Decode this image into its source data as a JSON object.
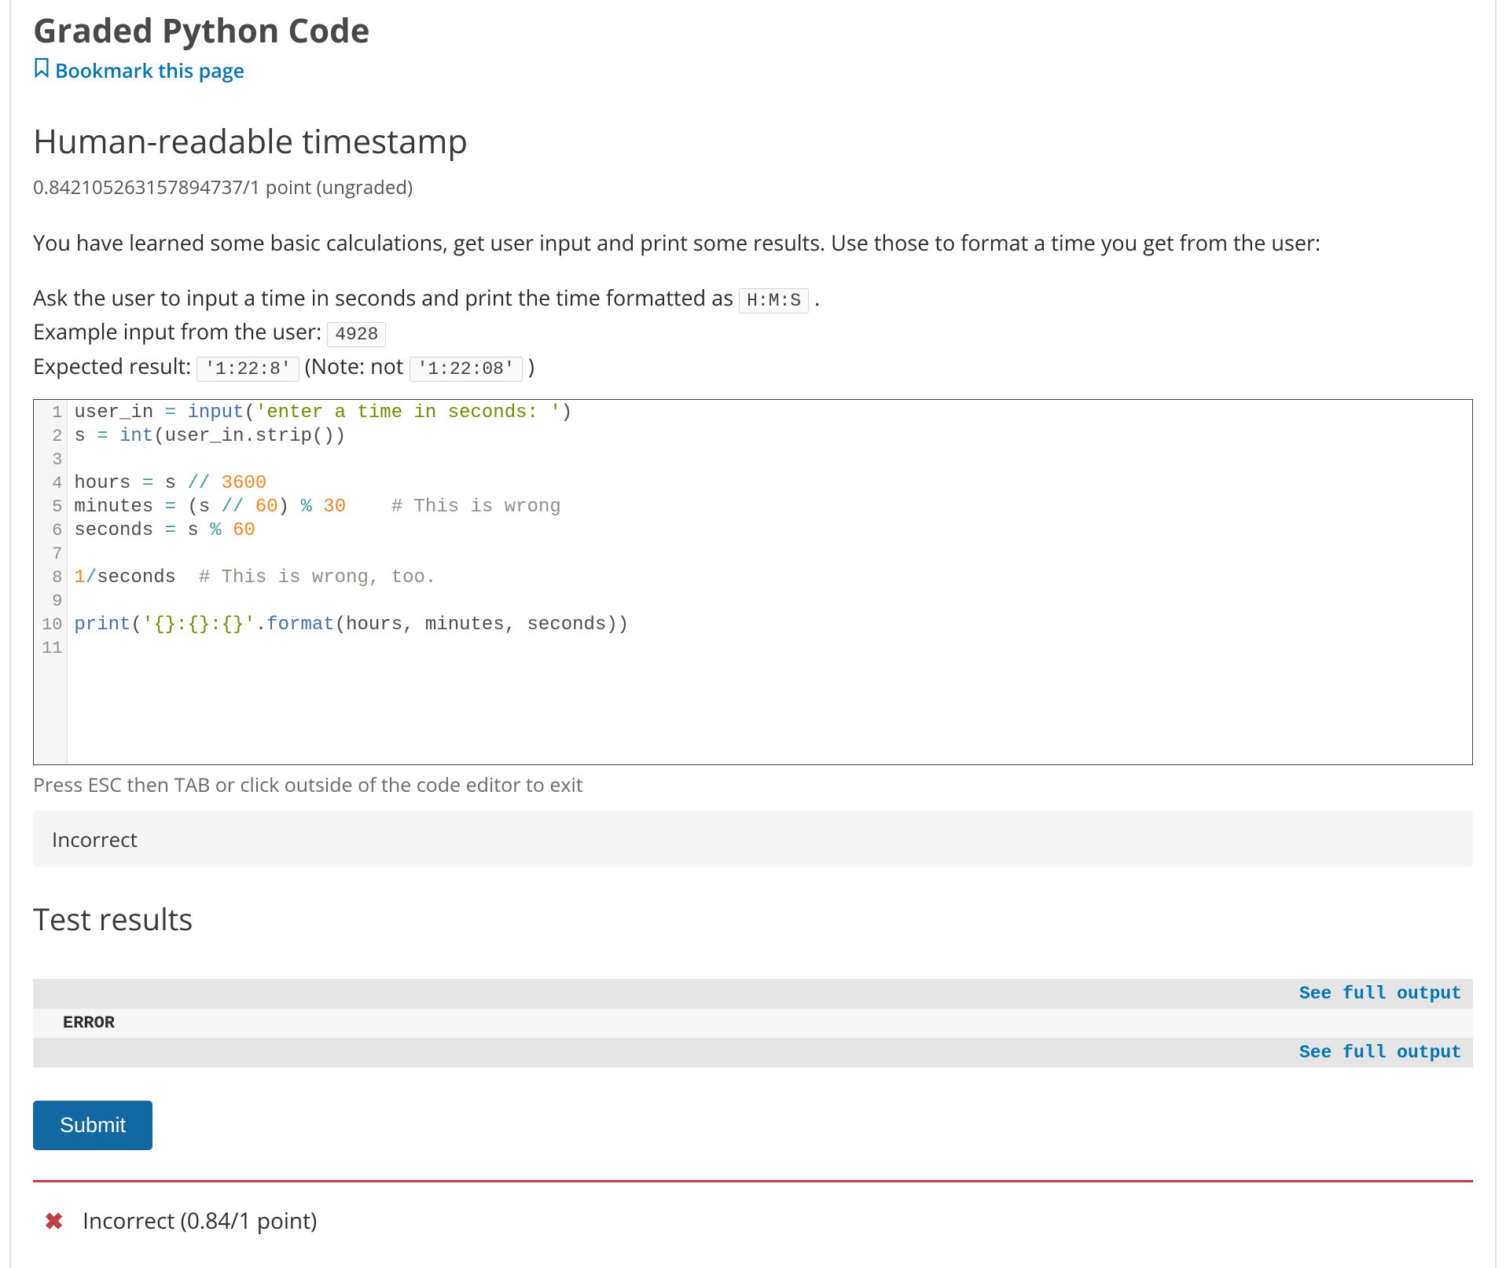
{
  "header": {
    "page_title": "Graded Python Code",
    "bookmark_label": "Bookmark this page"
  },
  "problem": {
    "title": "Human-readable timestamp",
    "score_line": "0.842105263157894737/1 point (ungraded)",
    "intro": "You have learned some basic calculations, get user input and print some results. Use those to format a time you get from the user:",
    "ask_line_prefix": "Ask the user to input a time in seconds and print the time formatted as ",
    "ask_code": "H:M:S",
    "ask_line_suffix": ".",
    "example_prefix": "Example input from the user: ",
    "example_code": "4928",
    "expected_prefix": "Expected result: ",
    "expected_code": "'1:22:8'",
    "expected_mid": "  (Note: not ",
    "expected_wrong_code": "'1:22:08'",
    "expected_suffix": "  )"
  },
  "code": {
    "lines": [
      {
        "n": 1,
        "raw": "user_in = input('enter a time in seconds: ')"
      },
      {
        "n": 2,
        "raw": "s = int(user_in.strip())"
      },
      {
        "n": 3,
        "raw": ""
      },
      {
        "n": 4,
        "raw": "hours = s // 3600"
      },
      {
        "n": 5,
        "raw": "minutes = (s // 60) % 30    # This is wrong"
      },
      {
        "n": 6,
        "raw": "seconds = s % 60"
      },
      {
        "n": 7,
        "raw": ""
      },
      {
        "n": 8,
        "raw": "1/seconds  # This is wrong, too."
      },
      {
        "n": 9,
        "raw": ""
      },
      {
        "n": 10,
        "raw": "print('{}:{}:{}'.format(hours, minutes, seconds))"
      },
      {
        "n": 11,
        "raw": ""
      }
    ],
    "hint": "Press ESC then TAB or click outside of the code editor to exit"
  },
  "feedback": {
    "banner": "Incorrect",
    "results_title": "Test results",
    "rows": [
      {
        "left": "",
        "link": "See full output",
        "shade": "shaded"
      },
      {
        "left": "ERROR",
        "link": "",
        "shade": "light"
      },
      {
        "left": "",
        "link": "See full output",
        "shade": "shaded"
      }
    ],
    "submit_label": "Submit",
    "final_status": "Incorrect (0.84/1 point)"
  }
}
